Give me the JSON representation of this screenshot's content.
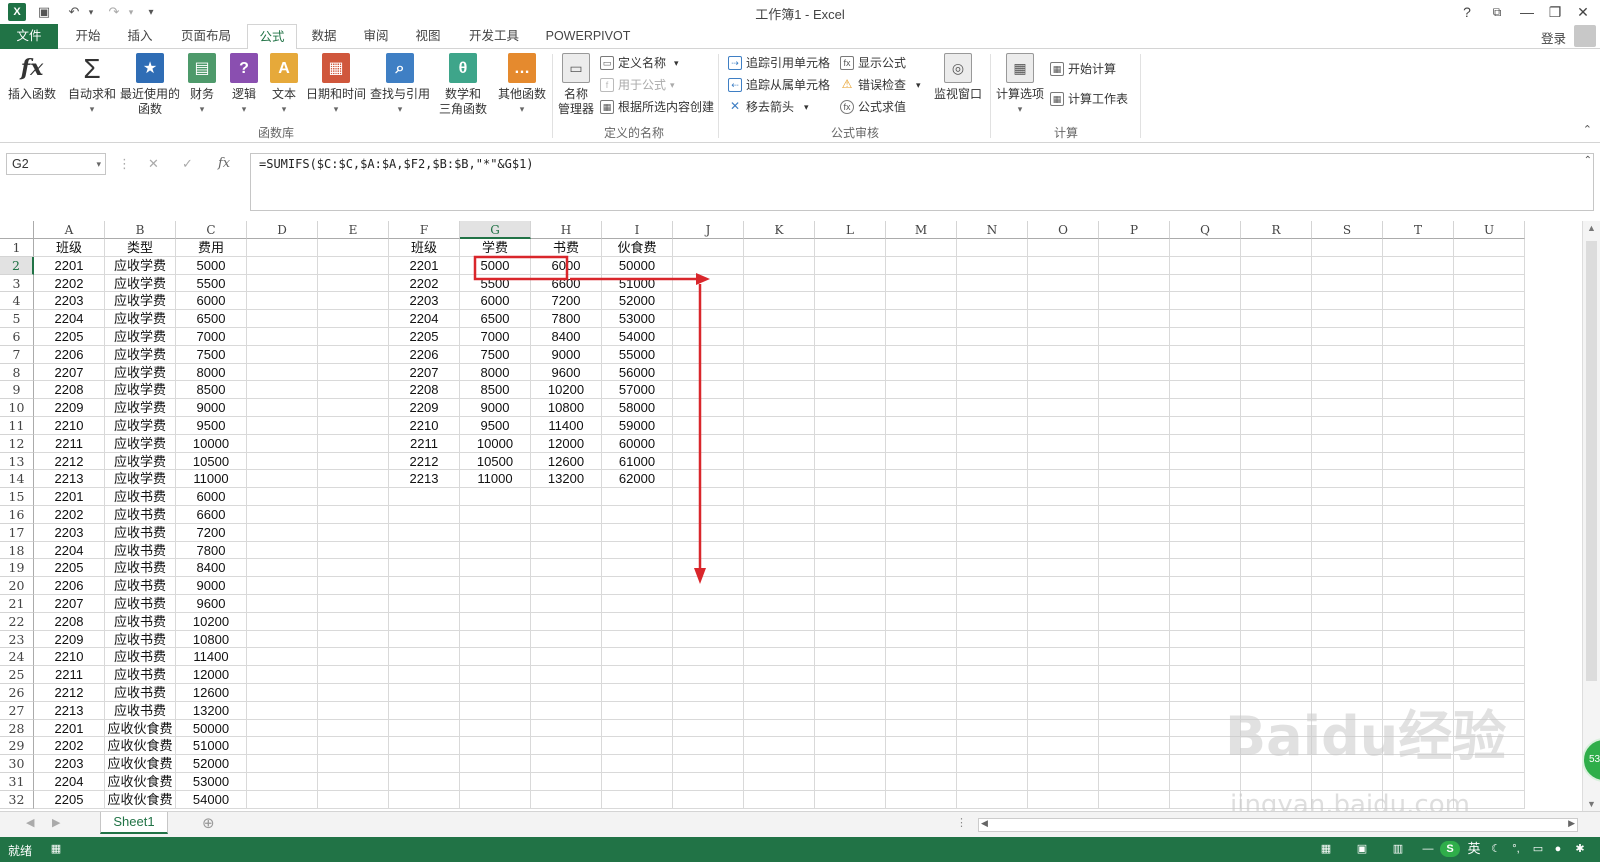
{
  "window": {
    "title": "工作簿1 - Excel",
    "help": "?",
    "ribbon_display": "⧉",
    "minimize": "—",
    "restore": "❐",
    "close": "✕",
    "app_icon": "X",
    "save_icon": "💾",
    "undo_icon": "↶",
    "redo_icon": "↷",
    "customize_icon": "▾"
  },
  "tabs": [
    "文件",
    "开始",
    "插入",
    "页面布局",
    "公式",
    "数据",
    "审阅",
    "视图",
    "开发工具",
    "POWERPIVOT"
  ],
  "active_tab": "公式",
  "login": "登录",
  "ribbon": {
    "function_library": {
      "label": "函数库",
      "buttons": [
        {
          "label": "插入函数",
          "icon": "fx-icon",
          "glyph": "fx",
          "color": "#ffffff"
        },
        {
          "label": "自动求和",
          "icon": "sum-icon",
          "glyph": "Σ",
          "color": "#ffffff",
          "dropdown": "▾"
        },
        {
          "label": "最近使用的\n函数",
          "icon": "star-book-icon",
          "glyph": "★",
          "color": "#2f6db5",
          "dropdown": "▾"
        },
        {
          "label": "财务",
          "icon": "finance-book-icon",
          "glyph": "▤",
          "color": "#4e9a6b",
          "dropdown": "▾"
        },
        {
          "label": "逻辑",
          "icon": "logic-book-icon",
          "glyph": "?",
          "color": "#8a4fb0",
          "dropdown": "▾"
        },
        {
          "label": "文本",
          "icon": "text-book-icon",
          "glyph": "A",
          "color": "#e6a93a",
          "dropdown": "▾"
        },
        {
          "label": "日期和时间",
          "icon": "datetime-book-icon",
          "glyph": "▦",
          "color": "#d0573c",
          "dropdown": "▾"
        },
        {
          "label": "查找与引用",
          "icon": "lookup-book-icon",
          "glyph": "⌕",
          "color": "#3f7fc4",
          "dropdown": "▾"
        },
        {
          "label": "数学和\n三角函数",
          "icon": "math-book-icon",
          "glyph": "θ",
          "color": "#3ea58a",
          "dropdown": "▾"
        },
        {
          "label": "其他函数",
          "icon": "more-functions-icon",
          "glyph": "…",
          "color": "#e58a2e",
          "dropdown": "▾"
        }
      ]
    },
    "defined_names": {
      "label": "定义的名称",
      "manager": "名称\n管理器",
      "define_name": "定义名称",
      "use_in_formula": "用于公式",
      "create_from_selection": "根据所选内容创建"
    },
    "formula_auditing": {
      "label": "公式审核",
      "trace_precedents": "追踪引用单元格",
      "trace_dependents": "追踪从属单元格",
      "remove_arrows": "移去箭头",
      "show_formulas": "显示公式",
      "error_checking": "错误检查",
      "evaluate_formula": "公式求值",
      "watch_window": "监视窗口"
    },
    "calculation": {
      "label": "计算",
      "calc_options": "计算选项",
      "calc_now": "开始计算",
      "calc_sheet": "计算工作表"
    }
  },
  "formula_bar": {
    "name_box": "G2",
    "cancel": "✕",
    "enter": "✓",
    "fx": "fx",
    "formula": "=SUMIFS($C:$C,$A:$A,$F2,$B:$B,\"*\"&G$1)"
  },
  "columns": [
    "A",
    "B",
    "C",
    "D",
    "E",
    "F",
    "G",
    "H",
    "I",
    "J",
    "K",
    "L",
    "M",
    "N",
    "O",
    "P",
    "Q",
    "R",
    "S",
    "T",
    "U"
  ],
  "selected_column": "G",
  "selected_row": 2,
  "rows": [
    {
      "n": 1,
      "A": "班级",
      "B": "类型",
      "C": "费用",
      "F": "班级",
      "G": "学费",
      "H": "书费",
      "I": "伙食费"
    },
    {
      "n": 2,
      "A": "2201",
      "B": "应收学费",
      "C": "5000",
      "F": "2201",
      "G": "5000",
      "H": "6000",
      "I": "50000"
    },
    {
      "n": 3,
      "A": "2202",
      "B": "应收学费",
      "C": "5500",
      "F": "2202",
      "G": "5500",
      "H": "6600",
      "I": "51000"
    },
    {
      "n": 4,
      "A": "2203",
      "B": "应收学费",
      "C": "6000",
      "F": "2203",
      "G": "6000",
      "H": "7200",
      "I": "52000"
    },
    {
      "n": 5,
      "A": "2204",
      "B": "应收学费",
      "C": "6500",
      "F": "2204",
      "G": "6500",
      "H": "7800",
      "I": "53000"
    },
    {
      "n": 6,
      "A": "2205",
      "B": "应收学费",
      "C": "7000",
      "F": "2205",
      "G": "7000",
      "H": "8400",
      "I": "54000"
    },
    {
      "n": 7,
      "A": "2206",
      "B": "应收学费",
      "C": "7500",
      "F": "2206",
      "G": "7500",
      "H": "9000",
      "I": "55000"
    },
    {
      "n": 8,
      "A": "2207",
      "B": "应收学费",
      "C": "8000",
      "F": "2207",
      "G": "8000",
      "H": "9600",
      "I": "56000"
    },
    {
      "n": 9,
      "A": "2208",
      "B": "应收学费",
      "C": "8500",
      "F": "2208",
      "G": "8500",
      "H": "10200",
      "I": "57000"
    },
    {
      "n": 10,
      "A": "2209",
      "B": "应收学费",
      "C": "9000",
      "F": "2209",
      "G": "9000",
      "H": "10800",
      "I": "58000"
    },
    {
      "n": 11,
      "A": "2210",
      "B": "应收学费",
      "C": "9500",
      "F": "2210",
      "G": "9500",
      "H": "11400",
      "I": "59000"
    },
    {
      "n": 12,
      "A": "2211",
      "B": "应收学费",
      "C": "10000",
      "F": "2211",
      "G": "10000",
      "H": "12000",
      "I": "60000"
    },
    {
      "n": 13,
      "A": "2212",
      "B": "应收学费",
      "C": "10500",
      "F": "2212",
      "G": "10500",
      "H": "12600",
      "I": "61000"
    },
    {
      "n": 14,
      "A": "2213",
      "B": "应收学费",
      "C": "11000",
      "F": "2213",
      "G": "11000",
      "H": "13200",
      "I": "62000"
    },
    {
      "n": 15,
      "A": "2201",
      "B": "应收书费",
      "C": "6000"
    },
    {
      "n": 16,
      "A": "2202",
      "B": "应收书费",
      "C": "6600"
    },
    {
      "n": 17,
      "A": "2203",
      "B": "应收书费",
      "C": "7200"
    },
    {
      "n": 18,
      "A": "2204",
      "B": "应收书费",
      "C": "7800"
    },
    {
      "n": 19,
      "A": "2205",
      "B": "应收书费",
      "C": "8400"
    },
    {
      "n": 20,
      "A": "2206",
      "B": "应收书费",
      "C": "9000"
    },
    {
      "n": 21,
      "A": "2207",
      "B": "应收书费",
      "C": "9600"
    },
    {
      "n": 22,
      "A": "2208",
      "B": "应收书费",
      "C": "10200"
    },
    {
      "n": 23,
      "A": "2209",
      "B": "应收书费",
      "C": "10800"
    },
    {
      "n": 24,
      "A": "2210",
      "B": "应收书费",
      "C": "11400"
    },
    {
      "n": 25,
      "A": "2211",
      "B": "应收书费",
      "C": "12000"
    },
    {
      "n": 26,
      "A": "2212",
      "B": "应收书费",
      "C": "12600"
    },
    {
      "n": 27,
      "A": "2213",
      "B": "应收书费",
      "C": "13200"
    },
    {
      "n": 28,
      "A": "2201",
      "B": "应收伙食费",
      "C": "50000"
    },
    {
      "n": 29,
      "A": "2202",
      "B": "应收伙食费",
      "C": "51000"
    },
    {
      "n": 30,
      "A": "2203",
      "B": "应收伙食费",
      "C": "52000"
    },
    {
      "n": 31,
      "A": "2204",
      "B": "应收伙食费",
      "C": "53000"
    },
    {
      "n": 32,
      "A": "2205",
      "B": "应收伙食费",
      "C": "54000"
    }
  ],
  "sheet_tabs": [
    "Sheet1"
  ],
  "add_sheet": "⊕",
  "status": {
    "ready": "就绪",
    "ime": "英",
    "zoom_minus": "—"
  },
  "watermark": {
    "brand": "Baidu经验",
    "url": "jingyan.baidu.com"
  },
  "badge": "53",
  "colors": {
    "excel_green": "#217346",
    "annotation_red": "#d9262b"
  }
}
